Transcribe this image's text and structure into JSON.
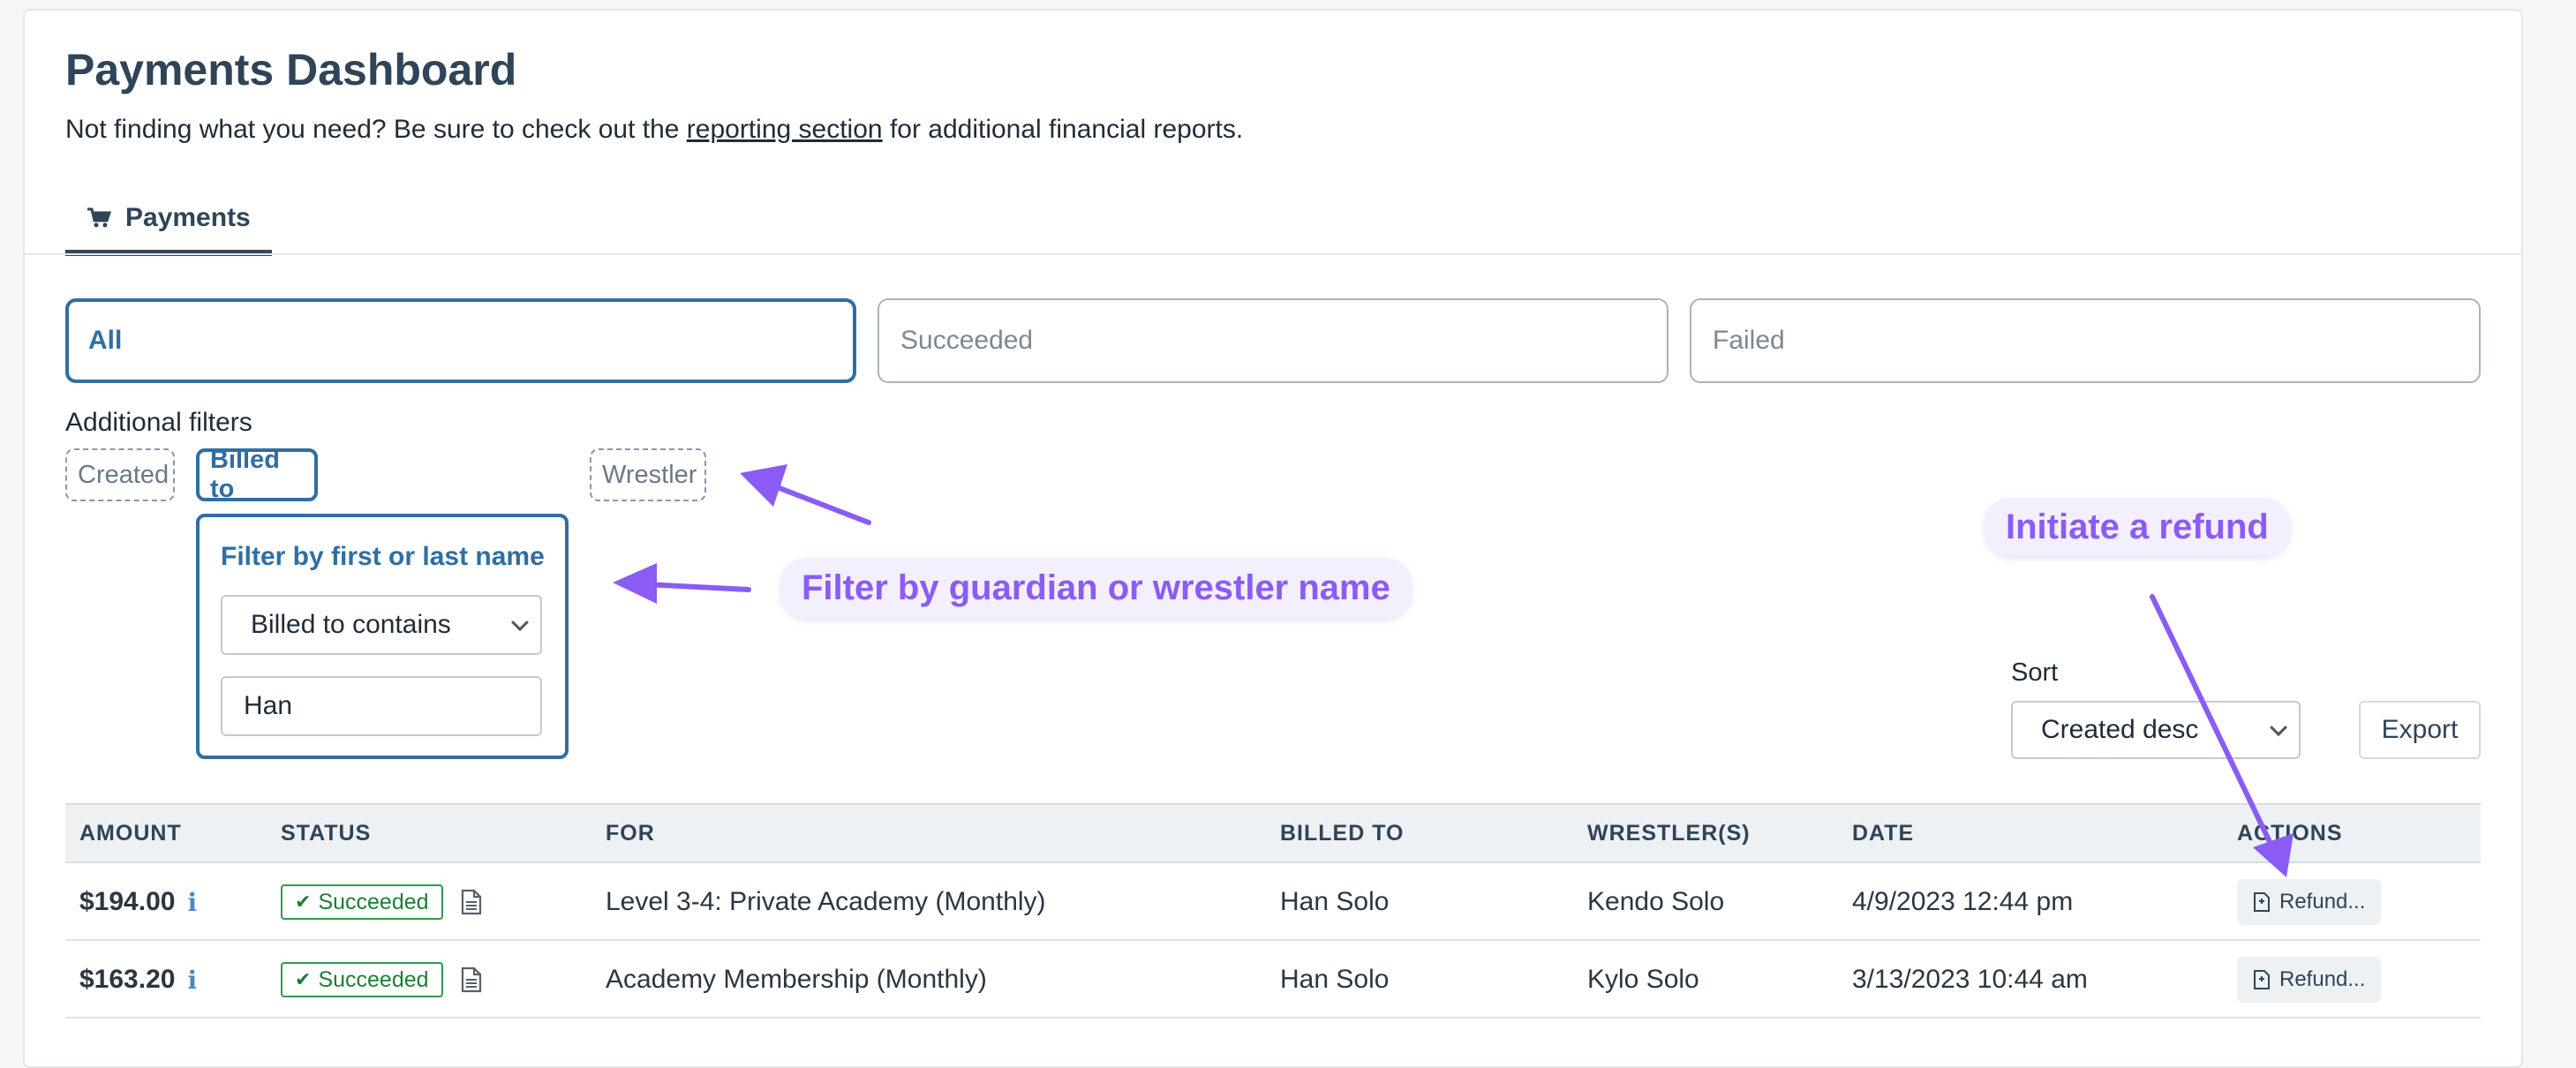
{
  "header": {
    "title": "Payments Dashboard",
    "subtitle_before": "Not finding what you need? Be sure to check out the",
    "subtitle_link": "reporting section",
    "subtitle_after": "for additional financial reports."
  },
  "tabs": [
    {
      "label": "Payments",
      "icon": "cart-icon"
    }
  ],
  "status_tabs": [
    "All",
    "Succeeded",
    "Failed"
  ],
  "filters": {
    "label": "Additional filters",
    "chips": [
      "Created",
      "Billed to",
      "Wrestler"
    ],
    "panel": {
      "title": "Filter by first or last name",
      "select_value": "Billed to contains",
      "input_value": "Han"
    }
  },
  "callouts": {
    "filter": "Filter by guardian or wrestler name",
    "refund": "Initiate a refund"
  },
  "sort": {
    "label": "Sort",
    "value": "Created desc"
  },
  "export_label": "Export",
  "table": {
    "headers": [
      "AMOUNT",
      "STATUS",
      "FOR",
      "BILLED TO",
      "WRESTLER(S)",
      "DATE",
      "ACTIONS"
    ],
    "rows": [
      {
        "amount": "$194.00",
        "status": "Succeeded",
        "for": "Level 3-4: Private Academy (Monthly)",
        "billed_to": "Han Solo",
        "wrestlers": "Kendo Solo",
        "date": "4/9/2023 12:44 pm",
        "action": "Refund..."
      },
      {
        "amount": "$163.20",
        "status": "Succeeded",
        "for": "Academy Membership (Monthly)",
        "billed_to": "Han Solo",
        "wrestlers": "Kylo Solo",
        "date": "3/13/2023 10:44 am",
        "action": "Refund..."
      }
    ]
  },
  "colors": {
    "accent": "#2f6ea3",
    "annotation": "#8a5cf5",
    "success": "#2f9a4a"
  }
}
